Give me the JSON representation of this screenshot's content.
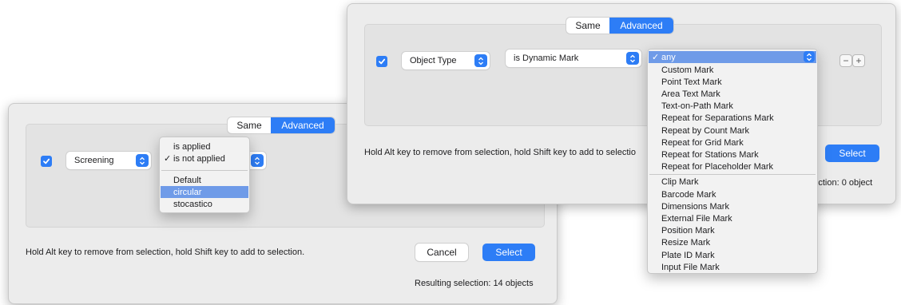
{
  "accent_color": "#2d7df6",
  "highlight_color": "#6f9be8",
  "icons": [
    "checkbox-icon",
    "popup-arrows-icon",
    "checkmark-icon",
    "minus-icon",
    "plus-icon"
  ],
  "dialog1": {
    "tabs": {
      "same": "Same",
      "advanced": "Advanced",
      "active": "Advanced"
    },
    "rule": {
      "checked": true,
      "field": "Screening",
      "condition_options": [
        {
          "label": "is applied",
          "checked": false
        },
        {
          "label": "is not applied",
          "checked": true
        }
      ],
      "value_options": [
        {
          "label": "Default",
          "highlighted": false
        },
        {
          "label": "circular",
          "highlighted": true
        },
        {
          "label": "stocastico",
          "highlighted": false
        }
      ]
    },
    "hint": "Hold Alt key to remove from selection, hold Shift key to add to selection.",
    "cancel_label": "Cancel",
    "select_label": "Select",
    "result": "Resulting selection: 14 objects"
  },
  "dialog2": {
    "tabs": {
      "same": "Same",
      "advanced": "Advanced",
      "active": "Advanced"
    },
    "rule": {
      "checked": true,
      "field": "Object Type",
      "condition": "is Dynamic Mark",
      "value_selected": "any",
      "value_options": [
        "Custom Mark",
        "Point Text Mark",
        "Area Text Mark",
        "Text-on-Path Mark",
        "Repeat for Separations Mark",
        "Repeat by Count Mark",
        "Repeat for Grid Mark",
        "Repeat for Stations Mark",
        "Repeat for Placeholder Mark",
        "Clip Mark",
        "Barcode Mark",
        "Dimensions Mark",
        "External File Mark",
        "Position Mark",
        "Resize Mark",
        "Plate ID Mark",
        "Input File Mark"
      ]
    },
    "hint": "Hold Alt key to remove from selection, hold Shift key to add to selectio",
    "select_label": "Select",
    "result": "g selection: 0 object"
  }
}
